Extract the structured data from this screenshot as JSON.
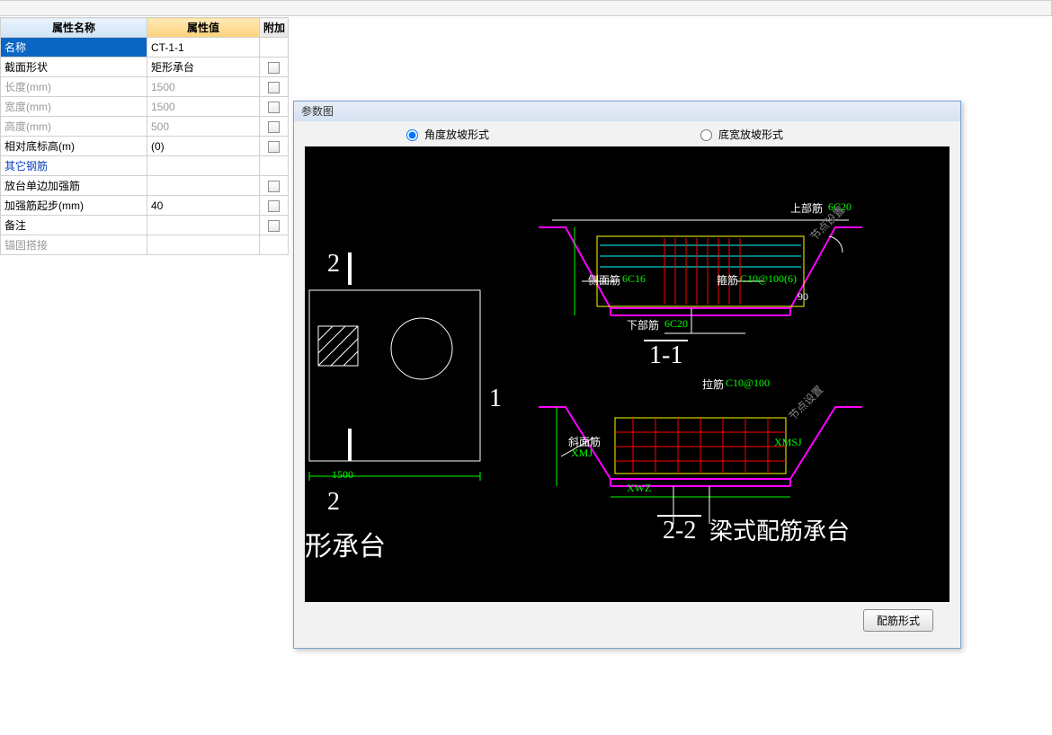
{
  "table": {
    "headers": {
      "name": "属性名称",
      "value": "属性值",
      "extra": "附加"
    },
    "rows": [
      {
        "name": "名称",
        "value": "CT-1-1",
        "checkbox": false,
        "selected": true
      },
      {
        "name": "截面形状",
        "value": "矩形承台",
        "checkbox": true
      },
      {
        "name": "长度(mm)",
        "value": "1500",
        "checkbox": true,
        "disabled": true
      },
      {
        "name": "宽度(mm)",
        "value": "1500",
        "checkbox": true,
        "disabled": true
      },
      {
        "name": "高度(mm)",
        "value": "500",
        "checkbox": true,
        "disabled": true
      },
      {
        "name": "相对底标高(m)",
        "value": "(0)",
        "checkbox": true
      },
      {
        "name": "其它钢筋",
        "value": "",
        "checkbox": false,
        "link": true
      },
      {
        "name": "放台单边加强筋",
        "value": "",
        "checkbox": true
      },
      {
        "name": "加强筋起步(mm)",
        "value": "40",
        "checkbox": true
      },
      {
        "name": "备注",
        "value": "",
        "checkbox": true
      },
      {
        "name": "锚固搭接",
        "value": "",
        "checkbox": false,
        "disabled": true
      }
    ]
  },
  "dialog": {
    "title": "参数图",
    "radios": {
      "r1": "角度放坡形式",
      "r2": "底宽放坡形式"
    },
    "button": "配筋形式"
  },
  "drawing": {
    "left": {
      "num2a": "2",
      "num2b": "2",
      "num1": "1",
      "dim": "1500",
      "label": "形承台"
    },
    "section1": {
      "title": "1-1",
      "top_label": "上部筋",
      "top_spec": "6C20",
      "side_label": "侧面筋",
      "side_spec": "6C16",
      "stirrup_label": "箍筋",
      "stirrup_spec": "C10@100(6)",
      "bottom_label": "下部筋",
      "bottom_spec": "6C20",
      "angle": "90",
      "note": "节点设置"
    },
    "section2": {
      "title": "2-2",
      "tie_label": "拉筋",
      "tie_spec": "C10@100",
      "slant_label": "斜面筋",
      "xmj": "XMJ",
      "xmsj": "XMSJ",
      "xwz": "XWZ",
      "note": "节点设置",
      "big_label": "梁式配筋承台"
    }
  }
}
